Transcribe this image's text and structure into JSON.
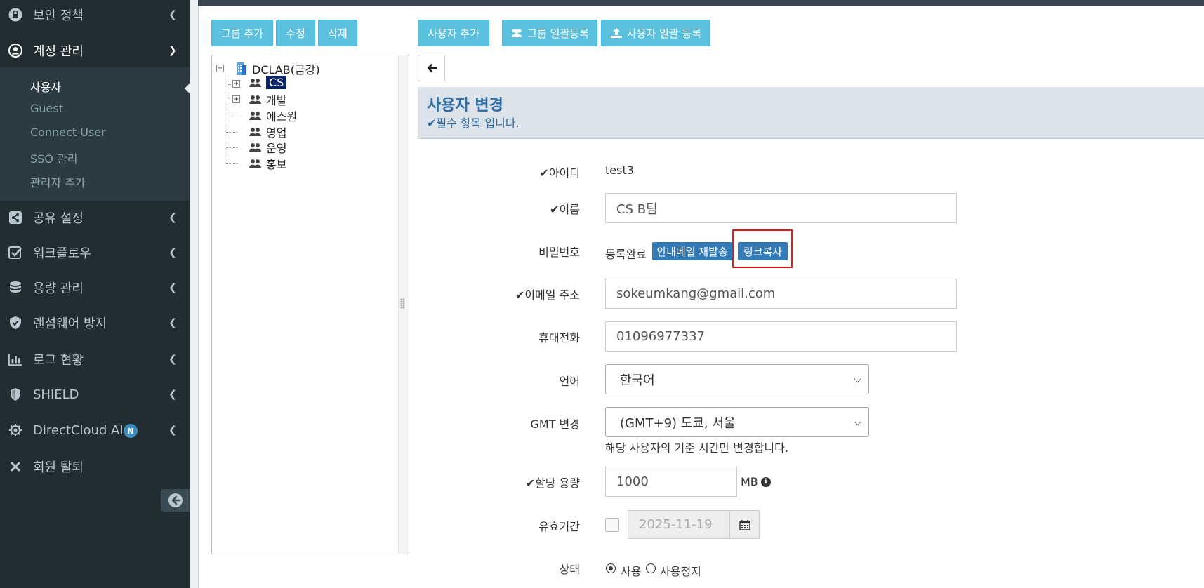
{
  "sidebar": {
    "security_policy": "보안 정책",
    "account_mgmt": "계정 관리",
    "sub_items": [
      "사용자",
      "Guest",
      "Connect User",
      "SSO 관리",
      "관리자 추가"
    ],
    "share_settings": "공유 설정",
    "workflow": "워크플로우",
    "capacity_mgmt": "용량 관리",
    "ransomware": "랜섬웨어 방지",
    "log_status": "로그 현황",
    "shield": "SHIELD",
    "directcloud_ai": "DirectCloud AI",
    "ai_badge": "N",
    "withdraw": "회원 탈퇴"
  },
  "toolbar": {
    "add_group": "그룹 추가",
    "edit": "수정",
    "delete": "삭제",
    "add_user": "사용자 추가",
    "bulk_group": "그룹 일괄등록",
    "bulk_user": "사용자 일괄 등록"
  },
  "tree": {
    "root": "DCLAB(금강)",
    "groups": [
      "CS",
      "개발",
      "에스원",
      "영업",
      "운영",
      "홍보"
    ],
    "selected": "CS"
  },
  "form": {
    "title": "사용자 변경",
    "required_note": "필수 항목 입니다.",
    "fields": {
      "id_label": "아이디",
      "id_value": "test3",
      "name_label": "이름",
      "name_value": "CS B팀",
      "password_label": "비밀번호",
      "password_status": "등록완료",
      "resend_mail": "안내메일 재발송",
      "copy_link": "링크복사",
      "email_label": "이메일 주소",
      "email_value": "sokeumkang@gmail.com",
      "phone_label": "휴대전화",
      "phone_value": "01096977337",
      "language_label": "언어",
      "language_value": "한국어",
      "gmt_label": "GMT 변경",
      "gmt_value": "(GMT+9) 도쿄, 서울",
      "gmt_note": "해당 사용자의 기준 시간만 변경합니다.",
      "quota_label": "할당 용량",
      "quota_value": "1000",
      "quota_unit": "MB",
      "expiry_label": "유효기간",
      "expiry_value": "2025-11-19",
      "status_label": "상태",
      "status_active": "사용",
      "status_suspended": "사용정지"
    }
  },
  "colors": {
    "sidebar_bg": "#222d32",
    "info_button": "#5bc0de",
    "primary_button": "#337ab7",
    "highlight_box": "#e01b1b",
    "title_blue": "#2e6da4"
  }
}
